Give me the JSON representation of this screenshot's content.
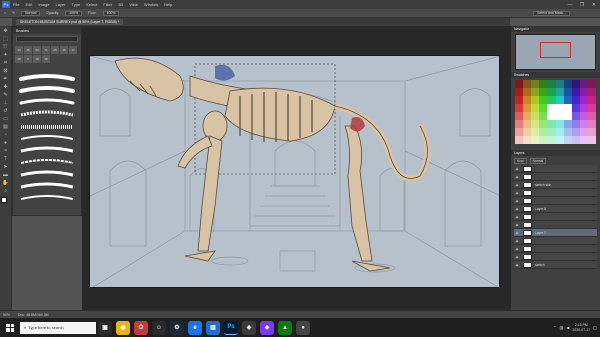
{
  "app": {
    "logo": "Ps"
  },
  "menu": [
    "File",
    "Edit",
    "Image",
    "Layer",
    "Type",
    "Select",
    "Filter",
    "3D",
    "View",
    "Window",
    "Help"
  ],
  "window_controls": [
    "—",
    "❐",
    "✕"
  ],
  "options_bar": {
    "mode": "Normal",
    "opacity_label": "Opacity:",
    "opacity": "100%",
    "flow_label": "Flow:",
    "flow": "100%",
    "select_mask": "Select and Mask..."
  },
  "document": {
    "tab": "SKELETON MUSEUM SURREY.psd @ 50% (Layer 7, RGB/8) *"
  },
  "brushes_panel": {
    "title": "Brushes",
    "presets": [
      "13",
      "25",
      "50",
      "71",
      "25",
      "15",
      "17",
      "18",
      "5",
      "10",
      "18"
    ]
  },
  "navigator": {
    "title": "Navigator"
  },
  "swatches": {
    "title": "Swatches"
  },
  "layers": {
    "title": "Layers",
    "kind": "Kind",
    "mode": "Normal",
    "items": [
      {
        "name": "",
        "active": false
      },
      {
        "name": "",
        "active": false
      },
      {
        "name": "sketch skin",
        "active": false
      },
      {
        "name": "",
        "active": false
      },
      {
        "name": "",
        "active": false
      },
      {
        "name": "Layer 8",
        "active": false
      },
      {
        "name": "",
        "active": false
      },
      {
        "name": "",
        "active": false
      },
      {
        "name": "Layer 7",
        "active": true
      },
      {
        "name": "",
        "active": false
      },
      {
        "name": "",
        "active": false
      },
      {
        "name": "",
        "active": false
      },
      {
        "name": "sketch",
        "active": false
      }
    ]
  },
  "status": {
    "zoom": "50%",
    "doc": "Doc: 48.8M/369.3M"
  },
  "taskbar": {
    "search_placeholder": "Type here to search",
    "time": "2:15 PM",
    "date": "2020-07-17"
  },
  "colors": {
    "bone": "#d8c3a5",
    "bone_outline": "#5a4a3a",
    "canvas": "#b6c1cb",
    "accent_red": "#b5393a",
    "accent_blue": "#3a5aa0"
  }
}
